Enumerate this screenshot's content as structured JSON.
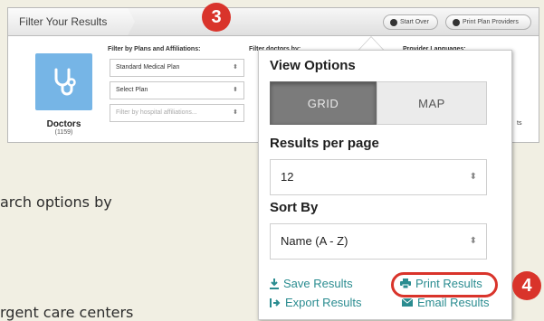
{
  "filter_panel": {
    "title": "Filter Your Results",
    "start_over": "Start Over",
    "print_plan_providers": "Print Plan Providers",
    "doctors_label": "Doctors",
    "doctors_count": "(1159)",
    "plans_heading": "Filter by Plans and Affiliations:",
    "plan_select_1": "Standard Medical Plan",
    "plan_select_2": "Select Plan",
    "plan_select_3": "Filter by hospital affiliations...",
    "doctors_by_heading": "Filter doctors by:",
    "languages_heading": "Provider Languages:",
    "results_heading_fragment": "ts"
  },
  "background": {
    "text_1": "arch options by",
    "text_2": "rgent care centers"
  },
  "badges": {
    "step_3": "3",
    "step_4": "4"
  },
  "view_options": {
    "title": "View Options",
    "grid_label": "GRID",
    "map_label": "MAP",
    "results_per_page_title": "Results per page",
    "results_per_page_value": "12",
    "sort_by_title": "Sort By",
    "sort_by_value": "Name (A - Z)",
    "save_results": "Save Results",
    "print_results": "Print Results",
    "export_results": "Export Results",
    "email_results": "Email Results"
  },
  "colors": {
    "accent": "#d9342b",
    "link": "#2a8c90",
    "tile": "#76b5e6"
  }
}
